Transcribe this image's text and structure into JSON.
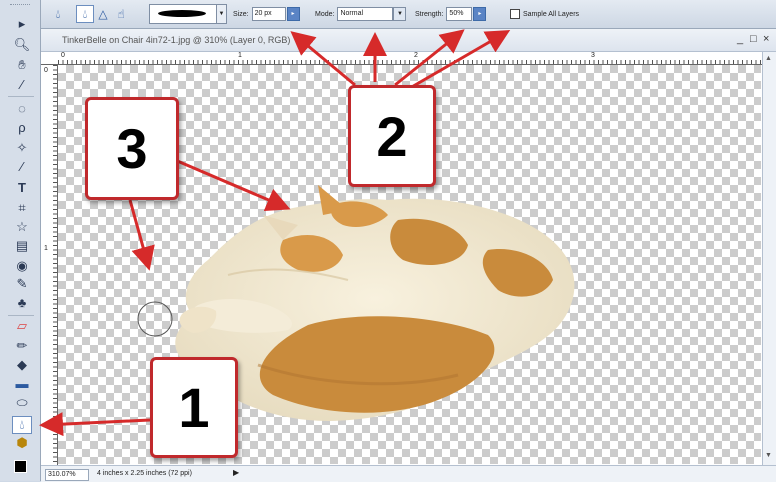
{
  "options_bar": {
    "size_label": "Size:",
    "size_value": "20 px",
    "mode_label": "Mode:",
    "mode_value": "Normal",
    "strength_label": "Strength:",
    "strength_value": "50%",
    "sample_all_layers_label": "Sample All Layers",
    "sample_all_layers_checked": false,
    "tool_icons": [
      "blur-icon",
      "sharpen-icon",
      "smudge-icon"
    ]
  },
  "document": {
    "title": "TinkerBelle on Chair 4in72-1.jpg @ 310% (Layer 0, RGB)",
    "minimize_label": "_",
    "restore_label": "□",
    "close_label": "×",
    "ruler_h_numbers": [
      "0",
      "1",
      "2",
      "3"
    ],
    "ruler_v_numbers": [
      "0",
      "1"
    ]
  },
  "status_bar": {
    "zoom": "310.07%",
    "info": "4 inches x 2.25 inches (72 ppi)"
  },
  "callouts": {
    "one": "1",
    "two": "2",
    "three": "3"
  },
  "colors": {
    "arrow_red": "#d62a2a",
    "callout_border": "#c0292c",
    "foreground": "#000000",
    "background": "#ffffff"
  }
}
